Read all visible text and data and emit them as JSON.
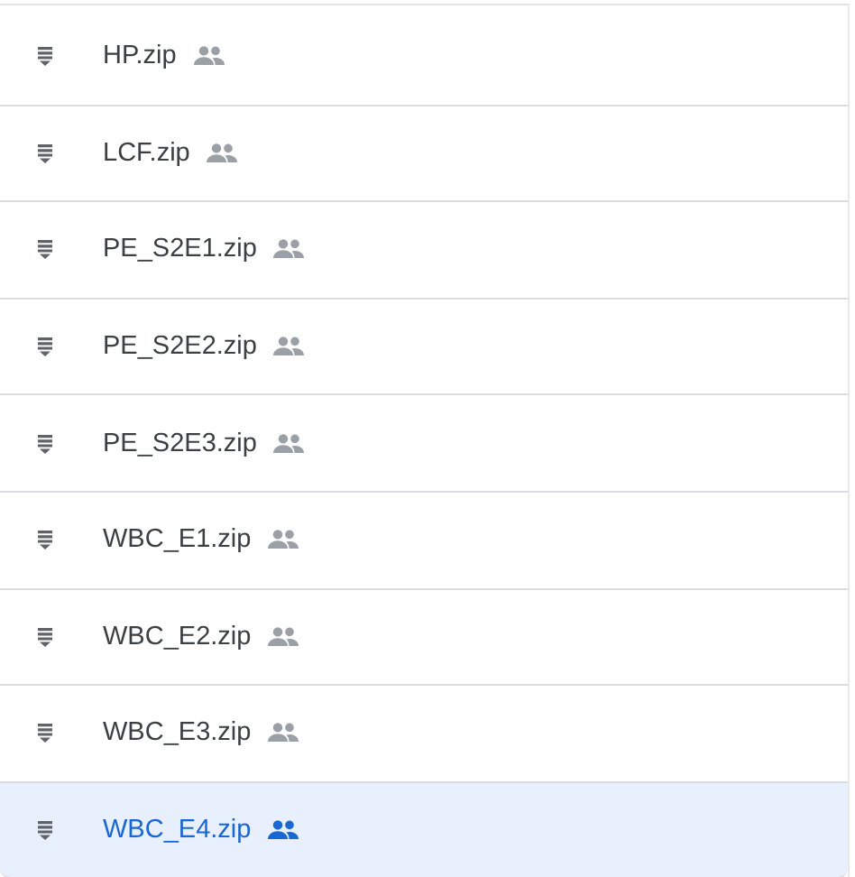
{
  "files": [
    {
      "name": "HP.zip",
      "shared": true,
      "selected": false
    },
    {
      "name": "LCF.zip",
      "shared": true,
      "selected": false
    },
    {
      "name": "PE_S2E1.zip",
      "shared": true,
      "selected": false
    },
    {
      "name": "PE_S2E2.zip",
      "shared": true,
      "selected": false
    },
    {
      "name": "PE_S2E3.zip",
      "shared": true,
      "selected": false
    },
    {
      "name": "WBC_E1.zip",
      "shared": true,
      "selected": false
    },
    {
      "name": "WBC_E2.zip",
      "shared": true,
      "selected": false
    },
    {
      "name": "WBC_E3.zip",
      "shared": true,
      "selected": false
    },
    {
      "name": "WBC_E4.zip",
      "shared": true,
      "selected": true
    }
  ]
}
